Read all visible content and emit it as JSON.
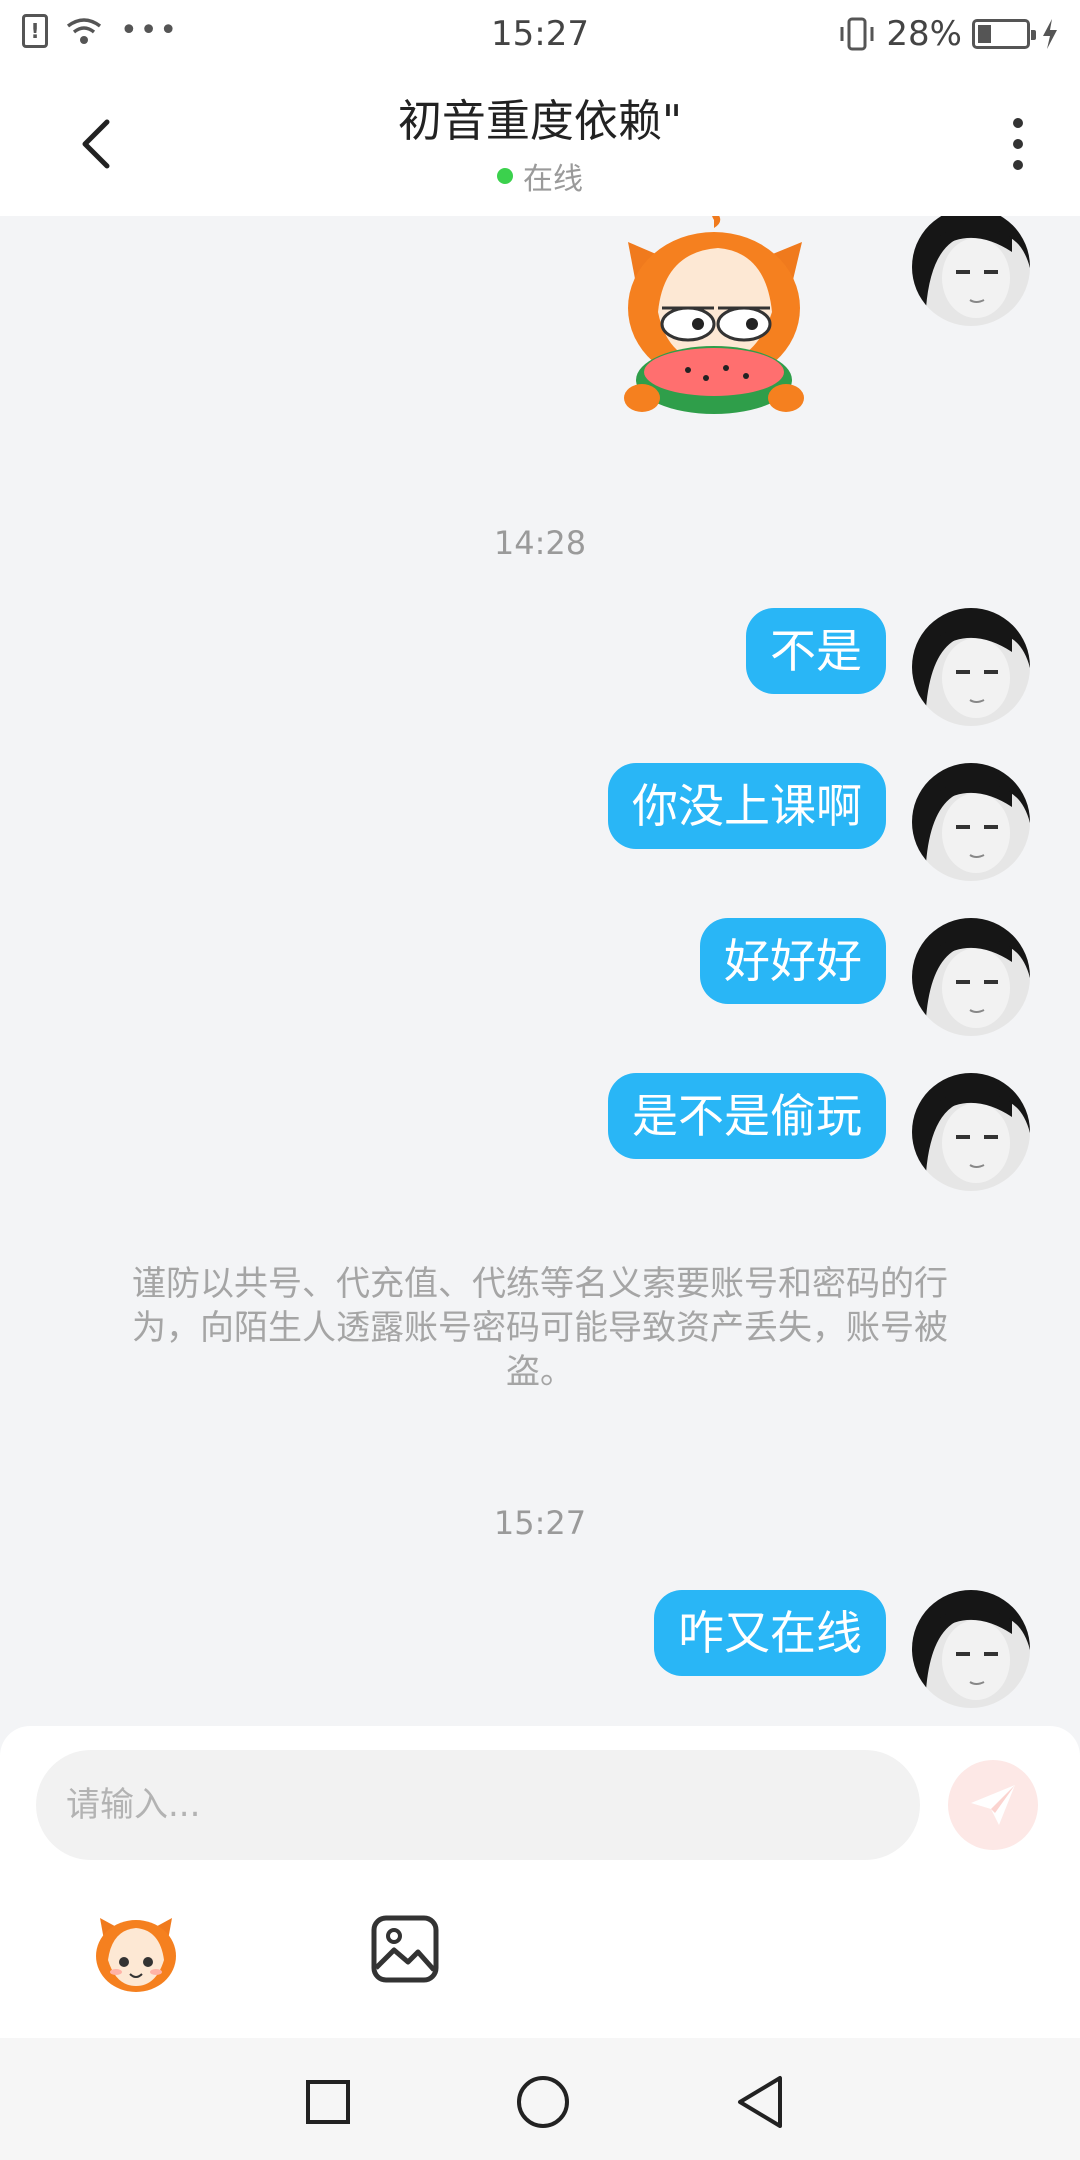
{
  "status_bar": {
    "time": "15:27",
    "battery_percent": "28%",
    "battery_level": 0.28,
    "more_icon": "•••",
    "icons": [
      "alert-icon",
      "wifi-icon",
      "more-icon",
      "vibrate-icon",
      "battery-icon",
      "charging-icon"
    ]
  },
  "header": {
    "title": "初音重度依赖\"",
    "status_text": "在线",
    "status_color": "#3bd14d",
    "back_icon": "chevron-left-icon",
    "menu_icon": "vertical-dots-icon"
  },
  "messages": {
    "sticker": "watermelon-mascot-sticker",
    "time_1": "14:28",
    "items": [
      {
        "text": "不是"
      },
      {
        "text": "你没上课啊"
      },
      {
        "text": "好好好"
      },
      {
        "text": "是不是偷玩"
      }
    ],
    "notice": "谨防以共号、代充值、代练等名义索要账号和密码的行为，向陌生人透露账号密码可能导致资产丢失，账号被盗。",
    "time_2": "15:27",
    "last": "咋又在线"
  },
  "composer": {
    "placeholder": "请输入...",
    "send_icon": "paper-plane-icon",
    "emoji_icon": "mascot-emoji-icon",
    "image_icon": "image-icon"
  },
  "nav": {
    "icons": [
      "recents-square-icon",
      "home-circle-icon",
      "back-triangle-icon"
    ]
  },
  "colors": {
    "bubble": "#29b6f6",
    "background": "#f3f4f6",
    "send_button": "#fde8e6"
  }
}
